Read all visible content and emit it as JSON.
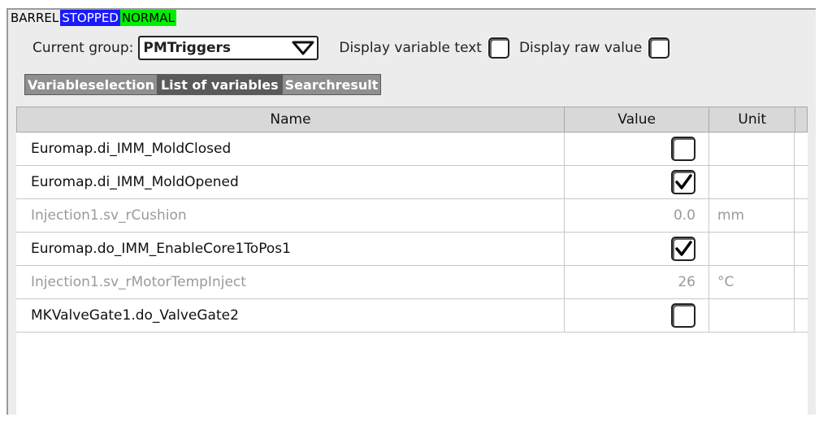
{
  "status": {
    "mode": "BARREL",
    "state": "STOPPED",
    "condition": "NORMAL",
    "state_color": "#1a1aff",
    "condition_color": "#00ee00"
  },
  "group": {
    "label": "Current group:",
    "value": "PMTriggers"
  },
  "options": {
    "display_text_label": "Display variable text",
    "display_text_checked": false,
    "display_raw_label": "Display raw value",
    "display_raw_checked": false
  },
  "tabs": [
    {
      "label": "Variableselection",
      "active": false
    },
    {
      "label": "List of variables",
      "active": true
    },
    {
      "label": "Searchresult",
      "active": false
    }
  ],
  "table": {
    "headers": {
      "name": "Name",
      "value": "Value",
      "unit": "Unit"
    },
    "rows": [
      {
        "name": "Euromap.di_IMM_MoldClosed",
        "type": "bool",
        "checked": false,
        "unit": "",
        "dim": false
      },
      {
        "name": "Euromap.di_IMM_MoldOpened",
        "type": "bool",
        "checked": true,
        "unit": "",
        "dim": false
      },
      {
        "name": "Injection1.sv_rCushion",
        "type": "num",
        "value": "0.0",
        "unit": "mm",
        "dim": true
      },
      {
        "name": "Euromap.do_IMM_EnableCore1ToPos1",
        "type": "bool",
        "checked": true,
        "unit": "",
        "dim": false
      },
      {
        "name": "Injection1.sv_rMotorTempInject",
        "type": "num",
        "value": "26",
        "unit": "°C",
        "dim": true
      },
      {
        "name": "MKValveGate1.do_ValveGate2",
        "type": "bool",
        "checked": false,
        "unit": "",
        "dim": false
      }
    ]
  }
}
